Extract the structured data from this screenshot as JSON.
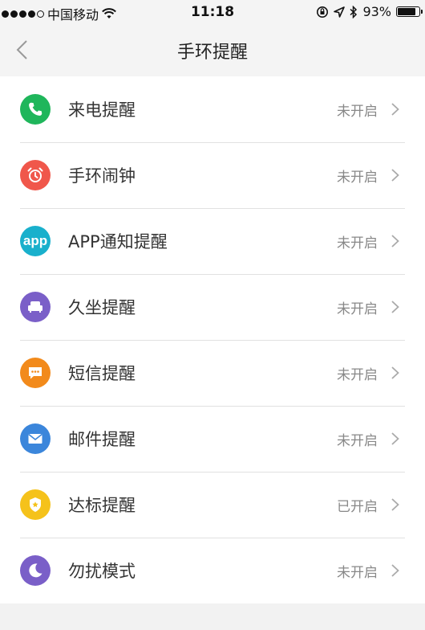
{
  "statusbar": {
    "carrier": "中国移动",
    "time": "11:18",
    "battery_text": "93%",
    "battery_level": 0.93
  },
  "nav": {
    "title": "手环提醒"
  },
  "items": [
    {
      "label": "来电提醒",
      "status": "未开启",
      "icon": "phone-icon",
      "color": "#1fb65b"
    },
    {
      "label": "手环闹钟",
      "status": "未开启",
      "icon": "alarm-clock-icon",
      "color": "#f0574b"
    },
    {
      "label": "APP通知提醒",
      "status": "未开启",
      "icon": "app-icon",
      "icon_text": "app",
      "color": "#19b0cc"
    },
    {
      "label": "久坐提醒",
      "status": "未开启",
      "icon": "sofa-icon",
      "color": "#7a5fc8"
    },
    {
      "label": "短信提醒",
      "status": "未开启",
      "icon": "message-icon",
      "color": "#f28a1b"
    },
    {
      "label": "邮件提醒",
      "status": "未开启",
      "icon": "mail-icon",
      "color": "#3b86db"
    },
    {
      "label": "达标提醒",
      "status": "已开启",
      "icon": "badge-icon",
      "color": "#f5c21b"
    },
    {
      "label": "勿扰模式",
      "status": "未开启",
      "icon": "moon-icon",
      "color": "#7a5fc8"
    }
  ]
}
